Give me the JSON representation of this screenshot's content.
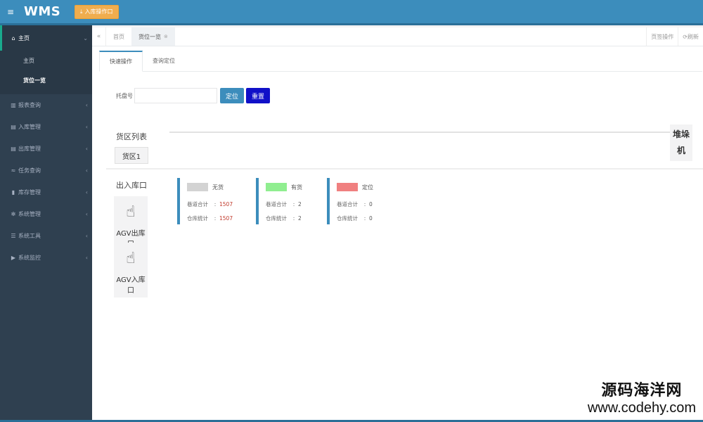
{
  "header": {
    "menu_icon": "hamburger-icon",
    "logo": "WMS",
    "top_button_label": "入库操作口"
  },
  "sidebar": {
    "items": [
      {
        "icon": "home-icon",
        "label": "主页",
        "expanded": true,
        "children": [
          {
            "label": "主页"
          },
          {
            "label": "货位一览"
          }
        ]
      },
      {
        "icon": "chart-icon",
        "label": "报表查询"
      },
      {
        "icon": "inbox-icon",
        "label": "入库管理"
      },
      {
        "icon": "outbox-icon",
        "label": "出库管理"
      },
      {
        "icon": "task-icon",
        "label": "任务查询"
      },
      {
        "icon": "stock-icon",
        "label": "库存管理"
      },
      {
        "icon": "gear-icon",
        "label": "系统管理"
      },
      {
        "icon": "tools-icon",
        "label": "系统工具"
      },
      {
        "icon": "video-icon",
        "label": "系统监控"
      }
    ]
  },
  "tabs": {
    "items": [
      "首页",
      "货位一览"
    ],
    "active": "货位一览",
    "right_actions": [
      "页签操作",
      "刷新"
    ]
  },
  "subtabs": {
    "items": [
      "快速操作",
      "查询定位"
    ],
    "active": "快速操作"
  },
  "form": {
    "pallet_label": "托盘号",
    "pallet_value": "",
    "locate_button": "定位",
    "reset_button": "重置"
  },
  "area": {
    "title": "货区列表",
    "area_button": "货区1",
    "stacker_line1": "堆垛",
    "stacker_line2": "机"
  },
  "ports": {
    "title": "出入库口",
    "agv_out_line1": "AGV出库",
    "agv_out_line2": "口",
    "agv_in_line1": "AGV入库",
    "agv_in_line2": "口"
  },
  "legend": [
    {
      "name": "无货",
      "color": "#d3d3d3",
      "lane_total_label": "巷道合计",
      "lane_total": "1507",
      "warehouse_total_label": "仓库统计",
      "warehouse_total": "1507",
      "value_color": "#c0392b"
    },
    {
      "name": "有货",
      "color": "#90ee90",
      "lane_total_label": "巷道合计",
      "lane_total": "2",
      "warehouse_total_label": "仓库统计",
      "warehouse_total": "2",
      "value_color": "#555555"
    },
    {
      "name": "定位",
      "color": "#f08080",
      "lane_total_label": "巷道合计",
      "lane_total": "0",
      "warehouse_total_label": "仓库统计",
      "warehouse_total": "0",
      "value_color": "#555555"
    }
  ],
  "watermark": {
    "line1": "源码海洋网",
    "line2": "www.codehy.com"
  }
}
